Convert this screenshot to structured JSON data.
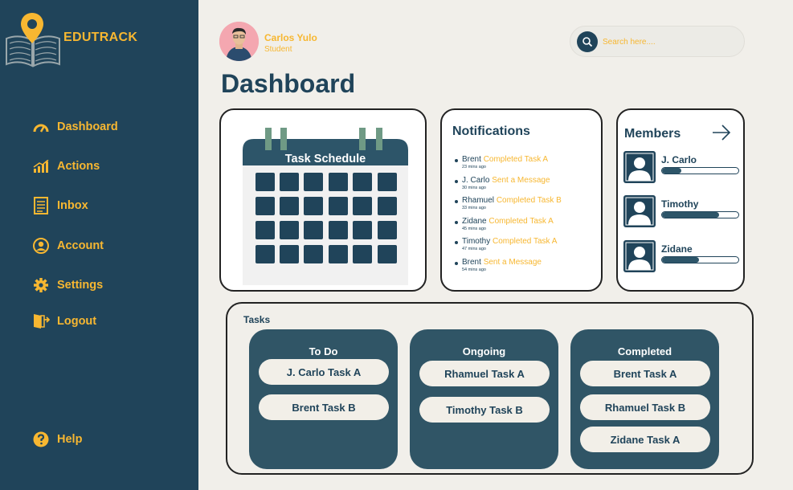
{
  "brand": {
    "name": "EDUTRACK"
  },
  "sidebar": {
    "items": [
      {
        "label": "Dashboard",
        "icon": "speedometer-icon"
      },
      {
        "label": "Actions",
        "icon": "bar-chart-icon"
      },
      {
        "label": "Inbox",
        "icon": "document-icon"
      },
      {
        "label": "Account",
        "icon": "user-circle-icon"
      },
      {
        "label": "Settings",
        "icon": "gear-icon"
      },
      {
        "label": "Logout",
        "icon": "door-exit-icon"
      }
    ],
    "help": {
      "label": "Help",
      "icon": "question-circle-icon"
    }
  },
  "user": {
    "name": "Carlos Yulo",
    "role": "Student"
  },
  "search": {
    "placeholder": "Search here...."
  },
  "page": {
    "title": "Dashboard"
  },
  "calendar": {
    "title": "Task Schedule"
  },
  "notifications": {
    "title": "Notifications",
    "items": [
      {
        "who": "Brent",
        "action": "Completed Task A",
        "time": "23 mins ago"
      },
      {
        "who": "J. Carlo",
        "action": "Sent a Message",
        "time": "30 mins ago"
      },
      {
        "who": "Rhamuel",
        "action": "Completed Task B",
        "time": "33 mins ago"
      },
      {
        "who": "Zidane",
        "action": "Completed Task A",
        "time": "45 mins ago"
      },
      {
        "who": "Timothy",
        "action": "Completed Task A",
        "time": "47 mins ago"
      },
      {
        "who": "Brent",
        "action": "Sent a Message",
        "time": "54 mins ago"
      }
    ]
  },
  "members": {
    "title": "Members",
    "items": [
      {
        "name": "J. Carlo",
        "progress": 0.25
      },
      {
        "name": "Timothy",
        "progress": 0.75
      },
      {
        "name": "Zidane",
        "progress": 0.48
      }
    ]
  },
  "tasks": {
    "label": "Tasks",
    "columns": [
      {
        "title": "To Do",
        "items": [
          "J. Carlo Task A",
          "Brent Task B"
        ]
      },
      {
        "title": "Ongoing",
        "items": [
          "Rhamuel Task A",
          "Timothy Task B"
        ]
      },
      {
        "title": "Completed",
        "items": [
          "Brent Task A",
          "Rhamuel Task B",
          "Zidane Task A"
        ]
      }
    ]
  },
  "colors": {
    "navy": "#20445a",
    "accent": "#f7b731",
    "background": "#f1efea"
  }
}
